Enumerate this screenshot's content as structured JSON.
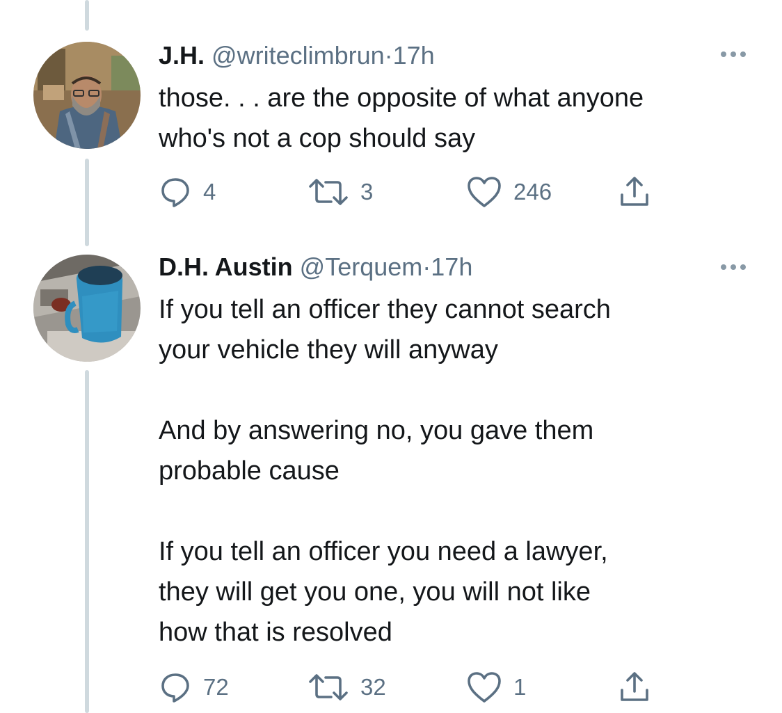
{
  "tweets": [
    {
      "name": "J.H.",
      "handle": "@writeclimbrun",
      "separator": "·",
      "time": "17h",
      "text": "those. . . are the opposite of what anyone\nwho's not a cop should say",
      "replies": "4",
      "retweets": "3",
      "likes": "246"
    },
    {
      "name": "D.H. Austin",
      "handle": "@Terquem",
      "separator": "·",
      "time": "17h",
      "text": "If you tell an officer they cannot search\nyour vehicle they will anyway\n\nAnd by answering no, you gave them\nprobable cause\n\nIf you tell an officer you need a lawyer,\nthey will get you one, you will not like\nhow that is resolved",
      "replies": "72",
      "retweets": "32",
      "likes": "1"
    }
  ],
  "icons": {
    "reply": "reply-icon",
    "retweet": "retweet-icon",
    "like": "heart-icon",
    "share": "share-icon",
    "more": "more-options-icon"
  },
  "colors": {
    "text": "#14171a",
    "muted": "#5b7083",
    "thread_line": "#cfd9de"
  }
}
